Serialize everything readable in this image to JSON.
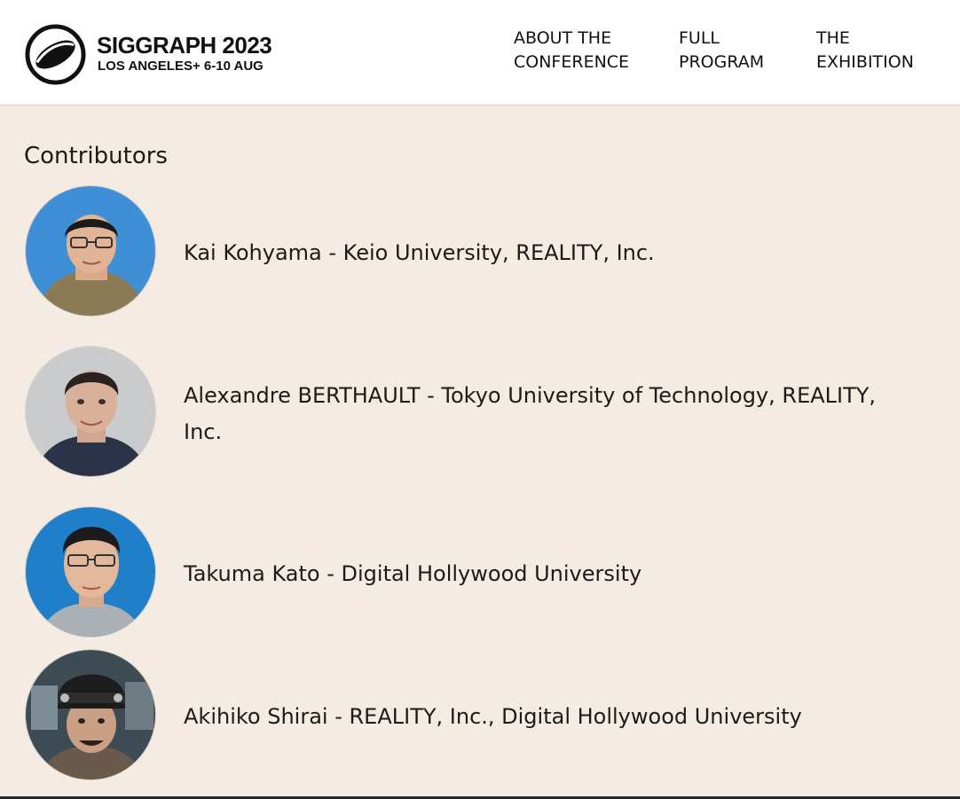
{
  "brand": {
    "title": "SIGGRAPH 2023",
    "subtitle": "LOS ANGELES+  6-10 AUG"
  },
  "nav": {
    "about": "ABOUT THE\nCONFERENCE",
    "program": "FULL\nPROGRAM",
    "exhibition": "THE\nEXHIBITION"
  },
  "section": {
    "title": "Contributors"
  },
  "contributors": [
    {
      "text": "Kai Kohyama - Keio University, REALITY, Inc."
    },
    {
      "text": "Alexandre BERTHAULT - Tokyo University of Technology, REALITY, Inc."
    },
    {
      "text": "Takuma Kato - Digital Hollywood University"
    },
    {
      "text": "Akihiko Shirai - REALITY, Inc., Digital Hollywood University"
    }
  ],
  "colors": {
    "page_bg": "#f4ebe3",
    "header_bg": "#ffffff",
    "text": "#1f1a17"
  }
}
